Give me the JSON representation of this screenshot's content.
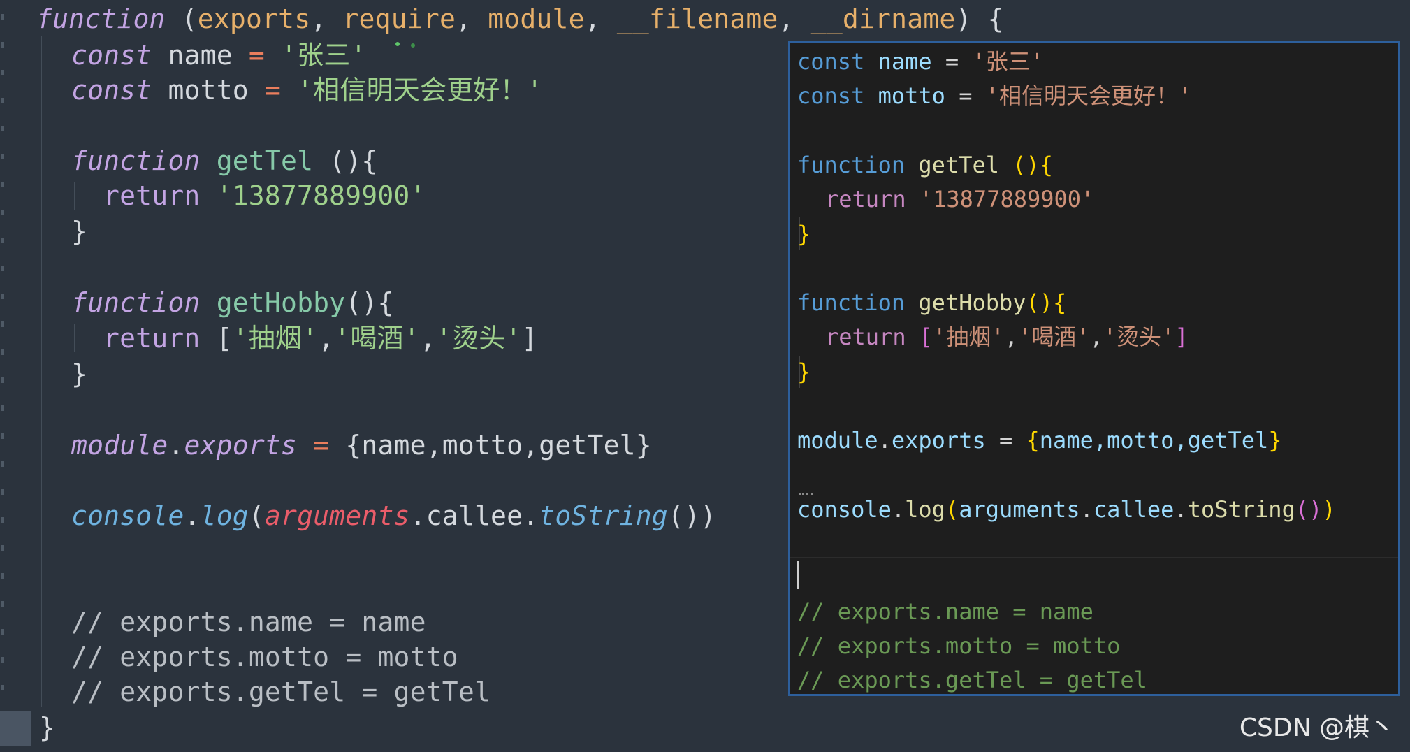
{
  "main": {
    "l1": {
      "kw": "function",
      "open": " (",
      "p1": "exports",
      "c1": ", ",
      "p2": "require",
      "c2": ", ",
      "p3": "module",
      "c3": ", ",
      "p4": "__filename",
      "c4": ", ",
      "p5": "__dirname",
      "close": ") {"
    },
    "l2": {
      "kw": "const",
      "name": " name ",
      "eq": "=",
      "str": " '张三'"
    },
    "l3": {
      "kw": "const",
      "name": " motto ",
      "eq": "=",
      "str": " '相信明天会更好！'"
    },
    "l5": {
      "kw": "function",
      "sp": " ",
      "fn": "getTel",
      "rest": " (){"
    },
    "l6": {
      "kw": "return",
      "str": " '13877889900'"
    },
    "l7": {
      "text": "}"
    },
    "l9": {
      "kw": "function",
      "sp": " ",
      "fn": "getHobby",
      "rest": "(){"
    },
    "l10": {
      "kw": "return",
      "open": " [",
      "s1": "'抽烟'",
      "c1": ",",
      "s2": "'喝酒'",
      "c2": ",",
      "s3": "'烫头'",
      "close": "]"
    },
    "l11": {
      "text": "}"
    },
    "l13": {
      "mod": "module",
      "dot": ".",
      "exp": "exports",
      "eq": " = ",
      "obj": "{name,motto,getTel}"
    },
    "l15": {
      "con": "console",
      "dot1": ".",
      "log": "log",
      "p1": "(",
      "arg": "arguments",
      "dot2": ".callee.",
      "ts": "toString",
      "p2": "())"
    },
    "l18": "// exports.name = name",
    "l19": "// exports.motto = motto",
    "l20": "// exports.getTel = getTel",
    "l21": "}"
  },
  "overlay": {
    "o1": {
      "kw": "const",
      "var": " name ",
      "eq": "=",
      "str": " '张三'"
    },
    "o2": {
      "kw": "const",
      "var": " motto ",
      "eq": "=",
      "str": " '相信明天会更好！'"
    },
    "o4": {
      "kw": "function",
      "fn": " getTel ",
      "br": "(){"
    },
    "o5": {
      "ret": "return",
      "str": " '13877889900'"
    },
    "o6": "}",
    "o8": {
      "kw": "function",
      "fn": " getHobby",
      "br": "(){"
    },
    "o9": {
      "ret": "return",
      "open": " [",
      "s1": "'抽烟'",
      "c1": ",",
      "s2": "'喝酒'",
      "c2": ",",
      "s3": "'烫头'",
      "close": "]"
    },
    "o10": "}",
    "o12": {
      "mod": "module",
      "dot": ".",
      "exp": "exports",
      "eq": " = ",
      "ob": "{",
      "body": "name,motto,getTel",
      "cb": "}"
    },
    "o14": {
      "con": "console",
      "dot1": ".",
      "log": "log",
      "p1": "(",
      "arg": "arguments",
      "dot2": ".",
      "callee": "callee",
      "dot3": ".",
      "ts": "toString",
      "p2": "()",
      "p3": ")"
    },
    "o17": "// exports.name = name",
    "o18": "// exports.motto = motto",
    "o19": "// exports.getTel = getTel"
  },
  "watermark": "CSDN @棋丶"
}
